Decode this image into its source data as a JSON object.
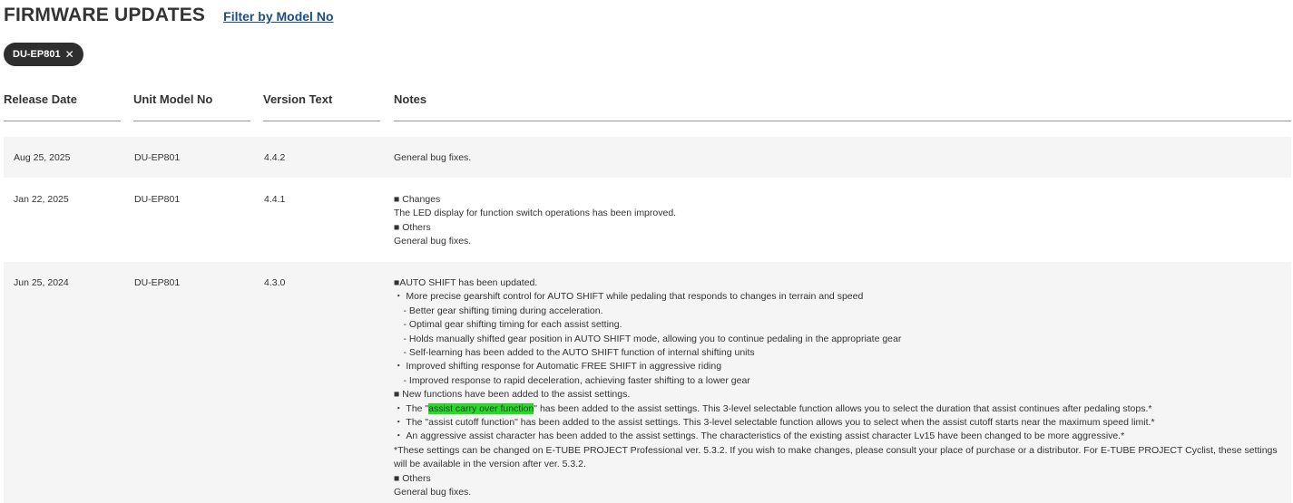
{
  "header": {
    "title": "FIRMWARE UPDATES",
    "filter_link": "Filter by Model No"
  },
  "filter_chip": {
    "label": "DU-EP801",
    "close_glyph": "✕"
  },
  "table": {
    "columns": [
      "Release Date",
      "Unit Model No",
      "Version Text",
      "Notes"
    ],
    "rows": [
      {
        "date": "Aug 25, 2025",
        "model": "DU-EP801",
        "version": "4.4.2",
        "notes": [
          "General bug fixes."
        ]
      },
      {
        "date": "Jan 22, 2025",
        "model": "DU-EP801",
        "version": "4.4.1",
        "notes": [
          "■ Changes",
          "The LED display for function switch operations has been improved.",
          "■ Others",
          "General bug fixes."
        ]
      },
      {
        "date": "Jun 25, 2024",
        "model": "DU-EP801",
        "version": "4.3.0",
        "notes": [
          "■AUTO SHIFT has been updated.",
          "・ More precise gearshift control for AUTO SHIFT while pedaling that responds to changes in terrain and speed",
          "　- Better gear shifting timing during acceleration.",
          "　- Optimal gear shifting timing for each assist setting.",
          "　- Holds manually shifted gear position in AUTO SHIFT mode, allowing you to continue pedaling in the appropriate gear",
          "　- Self-learning has been added to the AUTO SHIFT function of internal shifting units",
          "・ Improved shifting response for Automatic FREE SHIFT in aggressive riding",
          "　- Improved response to rapid deceleration, achieving faster shifting to a lower gear",
          "■ New functions have been added to the assist settings.",
          {
            "prefix": "・ The \"",
            "highlight": "assist carry over function",
            "suffix": "\" has been added to the assist settings. This 3-level selectable function allows you to select the duration that assist continues after pedaling stops.*"
          },
          "・ The \"assist cutoff function\" has been added to the assist settings. This 3-level selectable function allows you to select when the assist cutoff starts near the maximum speed limit.*",
          "・ An aggressive assist character has been added to the assist settings. The characteristics of the existing assist character Lv15 have been changed to be more aggressive.*",
          "*These settings can be changed on E-TUBE PROJECT Professional ver. 5.3.2. If you wish to make changes, please consult your place of purchase or a distributor. For E-TUBE PROJECT Cyclist, these settings will be available in the version after ver. 5.3.2.",
          "■ Others",
          "General bug fixes."
        ]
      }
    ]
  },
  "colors": {
    "title": "#333333",
    "link": "#1b4e87",
    "chip_bg": "#2e2e2e",
    "row_bg": "#f5f5f5",
    "highlight": "#22dd22"
  }
}
